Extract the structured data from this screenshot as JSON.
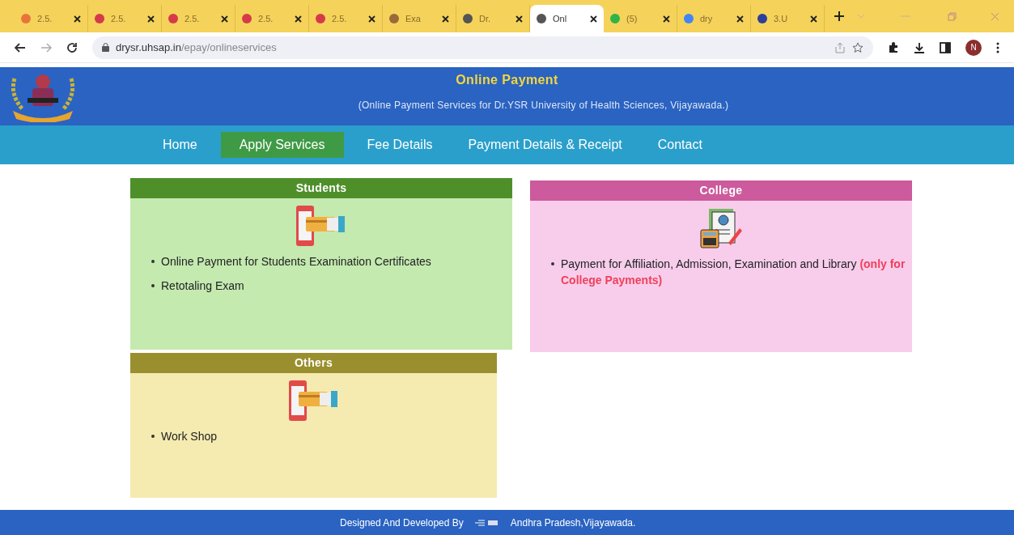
{
  "browser": {
    "tabs": [
      {
        "title": "2.5.",
        "color": "#e8743b",
        "selected": false
      },
      {
        "title": "2.5.",
        "color": "#d63a4a",
        "selected": false
      },
      {
        "title": "2.5.",
        "color": "#d63a4a",
        "selected": false
      },
      {
        "title": "2.5.",
        "color": "#d63a4a",
        "selected": false
      },
      {
        "title": "2.5.",
        "color": "#d63a4a",
        "selected": false
      },
      {
        "title": "Exa",
        "color": "#9a6a3a",
        "selected": false
      },
      {
        "title": "Dr.",
        "color": "#555555",
        "selected": false
      },
      {
        "title": "Onl",
        "color": "#555555",
        "selected": true
      },
      {
        "title": "(5)",
        "color": "#2fb34a",
        "selected": false
      },
      {
        "title": "dry",
        "color": "#4285f4",
        "selected": false
      },
      {
        "title": "3.U",
        "color": "#2d3f9a",
        "selected": false
      }
    ],
    "url_host": "drysr.uhsap.in",
    "url_path": "/epay/onlineservices",
    "avatar": "N"
  },
  "header": {
    "title": "Online Payment",
    "subtitle": "(Online Payment Services for Dr.YSR University of Health Sciences, Vijayawada.)"
  },
  "nav": [
    {
      "label": "Home",
      "selected": false
    },
    {
      "label": "Apply Services",
      "selected": true
    },
    {
      "label": "Fee Details",
      "selected": false
    },
    {
      "label": "Payment Details & Receipt",
      "selected": false
    },
    {
      "label": "Contact",
      "selected": false
    }
  ],
  "cards": [
    {
      "title": "Students",
      "kind": "payment",
      "color": "#4e8f2a",
      "items": [
        "Online Payment for Students Examination Certificates",
        "Retotaling Exam"
      ]
    },
    {
      "title": "College",
      "kind": "document",
      "color": "#cc5a9c",
      "items": [
        "Payment for Affiliation, Admission, Examination and Library **(only for College Payments)**"
      ]
    },
    {
      "title": "Others",
      "kind": "payment",
      "color": "#9a8f2e",
      "items": [
        "Work Shop"
      ]
    }
  ],
  "footer": {
    "text": "Designed And Developed By",
    "place": "Andhra Pradesh,Vijayawada."
  }
}
